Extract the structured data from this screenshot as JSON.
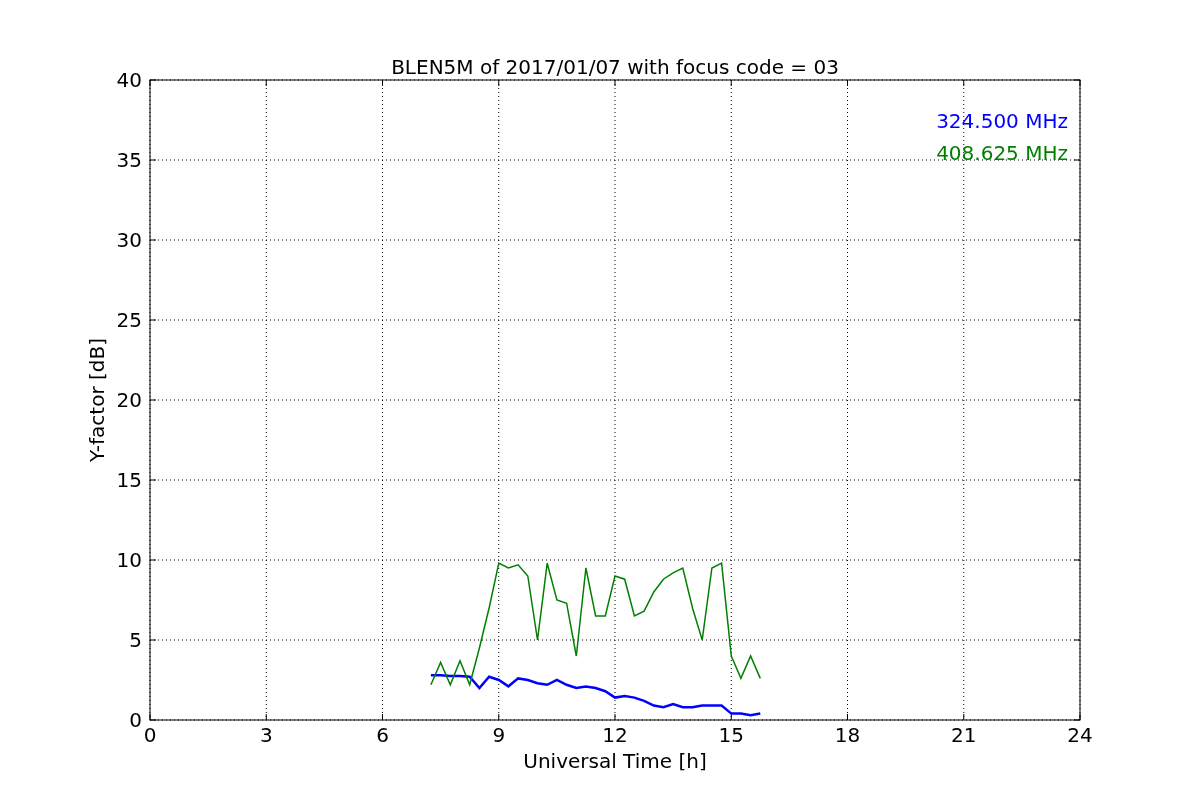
{
  "chart_data": {
    "type": "line",
    "title": "BLEN5M of 2017/01/07 with focus code = 03",
    "xlabel": "Universal Time [h]",
    "ylabel": "Y-factor [dB]",
    "xlim": [
      0,
      24
    ],
    "ylim": [
      0,
      40
    ],
    "xticks": [
      0,
      3,
      6,
      9,
      12,
      15,
      18,
      21,
      24
    ],
    "yticks": [
      0,
      5,
      10,
      15,
      20,
      25,
      30,
      35,
      40
    ],
    "grid": true,
    "x": [
      7.25,
      7.5,
      7.75,
      8,
      8.25,
      8.5,
      8.75,
      9,
      9.25,
      9.5,
      9.75,
      10,
      10.25,
      10.5,
      10.75,
      11,
      11.25,
      11.5,
      11.75,
      12,
      12.25,
      12.5,
      12.75,
      13,
      13.25,
      13.5,
      13.75,
      14,
      14.25,
      14.5,
      14.75,
      15,
      15.25,
      15.5,
      15.75
    ],
    "series": [
      {
        "name": "324.500 MHz",
        "color": "#0000ff",
        "values": [
          2.8,
          2.8,
          2.75,
          2.75,
          2.7,
          2.0,
          2.7,
          2.5,
          2.1,
          2.6,
          2.5,
          2.3,
          2.2,
          2.5,
          2.2,
          2.0,
          2.1,
          2.0,
          1.8,
          1.4,
          1.5,
          1.4,
          1.2,
          0.9,
          0.8,
          1.0,
          0.8,
          0.8,
          0.9,
          0.9,
          0.9,
          0.4,
          0.4,
          0.3,
          0.4
        ]
      },
      {
        "name": "408.625 MHz",
        "color": "#008000",
        "values": [
          2.2,
          3.6,
          2.2,
          3.7,
          2.2,
          4.5,
          7.0,
          9.8,
          9.5,
          9.7,
          9.0,
          5.0,
          9.8,
          7.5,
          7.3,
          4.0,
          9.5,
          6.5,
          6.5,
          9.0,
          8.8,
          6.5,
          6.8,
          8.0,
          8.8,
          9.2,
          9.5,
          7.0,
          5.0,
          9.5,
          9.8,
          4.0,
          2.6,
          4.0,
          2.6
        ]
      }
    ]
  }
}
